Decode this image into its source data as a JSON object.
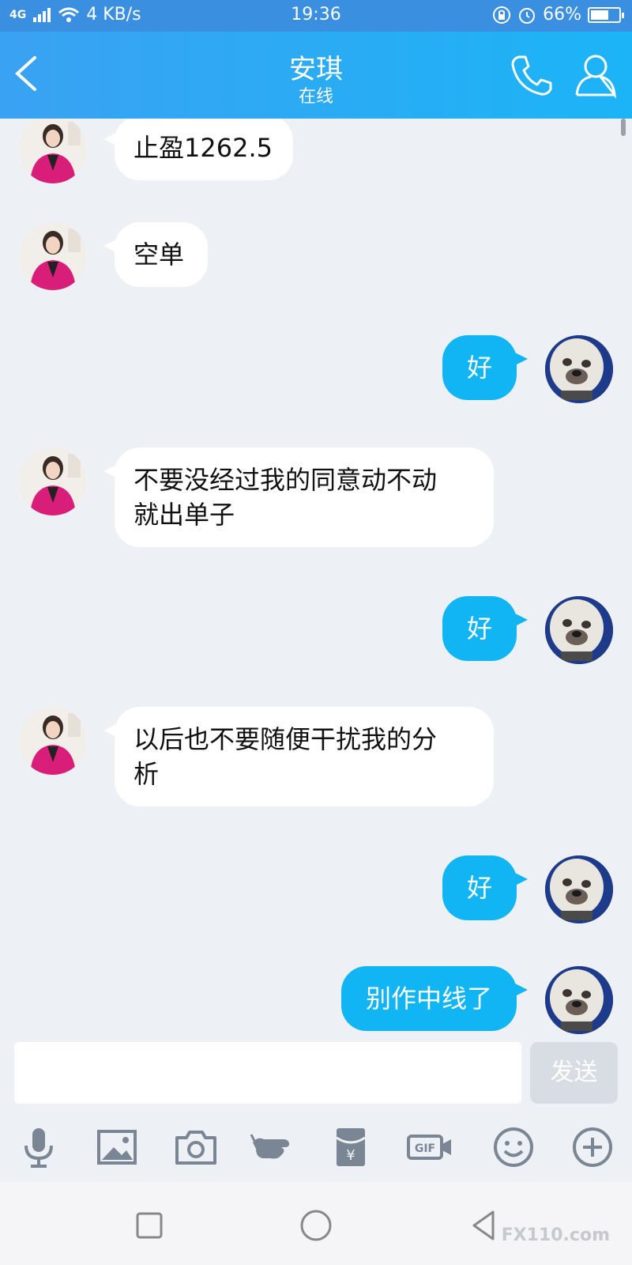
{
  "status_bar": {
    "network": "4G",
    "speed": "4 KB/s",
    "time": "19:36",
    "battery": "66%",
    "battery_level": 0.66
  },
  "header": {
    "title": "安琪",
    "subtitle": "在线"
  },
  "messages": [
    {
      "from": "her",
      "text": "止盈1262.5"
    },
    {
      "from": "her",
      "text": "空单"
    },
    {
      "from": "me",
      "text": "好"
    },
    {
      "from": "her",
      "text": "不要没经过我的同意动不动\n就出单子"
    },
    {
      "from": "me",
      "text": "好"
    },
    {
      "from": "her",
      "text": "以后也不要随便干扰我的分\n析"
    },
    {
      "from": "me",
      "text": "好"
    },
    {
      "from": "me",
      "text": "别作中线了"
    }
  ],
  "input": {
    "value": "",
    "send_label": "发送"
  },
  "toolbar": [
    "mic-icon",
    "image-icon",
    "camera-icon",
    "poke-icon",
    "red-packet-icon",
    "gif-icon",
    "emoji-icon",
    "plus-icon"
  ],
  "watermark": "FX110.com",
  "colors": {
    "header": "#1cb4f6",
    "outgoing": "#12b5f3",
    "incoming": "#ffffff",
    "background": "#edf0f5"
  }
}
